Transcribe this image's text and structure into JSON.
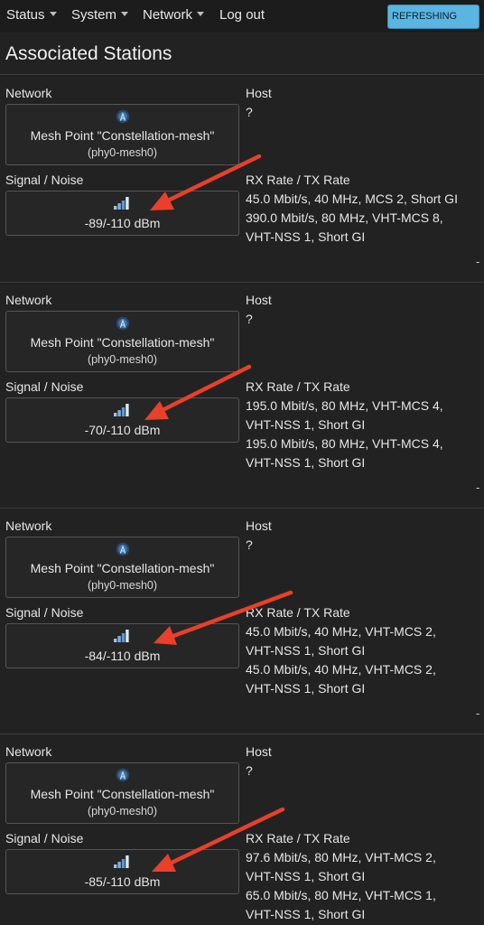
{
  "nav": {
    "items": [
      {
        "label": "Status",
        "dropdown": true
      },
      {
        "label": "System",
        "dropdown": true
      },
      {
        "label": "Network",
        "dropdown": true
      },
      {
        "label": "Log out",
        "dropdown": false
      }
    ],
    "refresh_button": "REFRESHING"
  },
  "page": {
    "title": "Associated Stations"
  },
  "labels": {
    "network": "Network",
    "host": "Host",
    "signal_noise": "Signal / Noise",
    "rx_tx_rate": "RX Rate / TX Rate"
  },
  "stations": [
    {
      "network_name": "Mesh Point \"Constellation-mesh\"",
      "network_device": "(phy0-mesh0)",
      "host": "?",
      "signal_noise": "-89/-110 dBm",
      "rate_lines": [
        "45.0 Mbit/s, 40 MHz, MCS 2, Short GI",
        "390.0 Mbit/s, 80 MHz, VHT-MCS 8,",
        "VHT-NSS 1, Short GI"
      ],
      "action": "-"
    },
    {
      "network_name": "Mesh Point \"Constellation-mesh\"",
      "network_device": "(phy0-mesh0)",
      "host": "?",
      "signal_noise": "-70/-110 dBm",
      "rate_lines": [
        "195.0 Mbit/s, 80 MHz, VHT-MCS 4,",
        "VHT-NSS 1, Short GI",
        "195.0 Mbit/s, 80 MHz, VHT-MCS 4,",
        "VHT-NSS 1, Short GI"
      ],
      "action": "-"
    },
    {
      "network_name": "Mesh Point \"Constellation-mesh\"",
      "network_device": "(phy0-mesh0)",
      "host": "?",
      "signal_noise": "-84/-110 dBm",
      "rate_lines": [
        "45.0 Mbit/s, 40 MHz, VHT-MCS 2,",
        "VHT-NSS 1, Short GI",
        "45.0 Mbit/s, 40 MHz, VHT-MCS 2,",
        "VHT-NSS 1, Short GI"
      ],
      "action": "-"
    },
    {
      "network_name": "Mesh Point \"Constellation-mesh\"",
      "network_device": "(phy0-mesh0)",
      "host": "?",
      "signal_noise": "-85/-110 dBm",
      "rate_lines": [
        "97.6 Mbit/s, 80 MHz, VHT-MCS 2,",
        "VHT-NSS 1, Short GI",
        "65.0 Mbit/s, 80 MHz, VHT-MCS 1,",
        "VHT-NSS 1, Short GI"
      ],
      "action": "-"
    }
  ],
  "colors": {
    "background": "#222222",
    "topbar": "#1c1c1c",
    "refresh_button": "#5bb5e0",
    "annotation_arrow": "#e8402a"
  },
  "icons": {
    "network": "mesh-antenna-icon",
    "signal": "signal-bars-icon",
    "annotation": "red-arrow-annotation"
  }
}
